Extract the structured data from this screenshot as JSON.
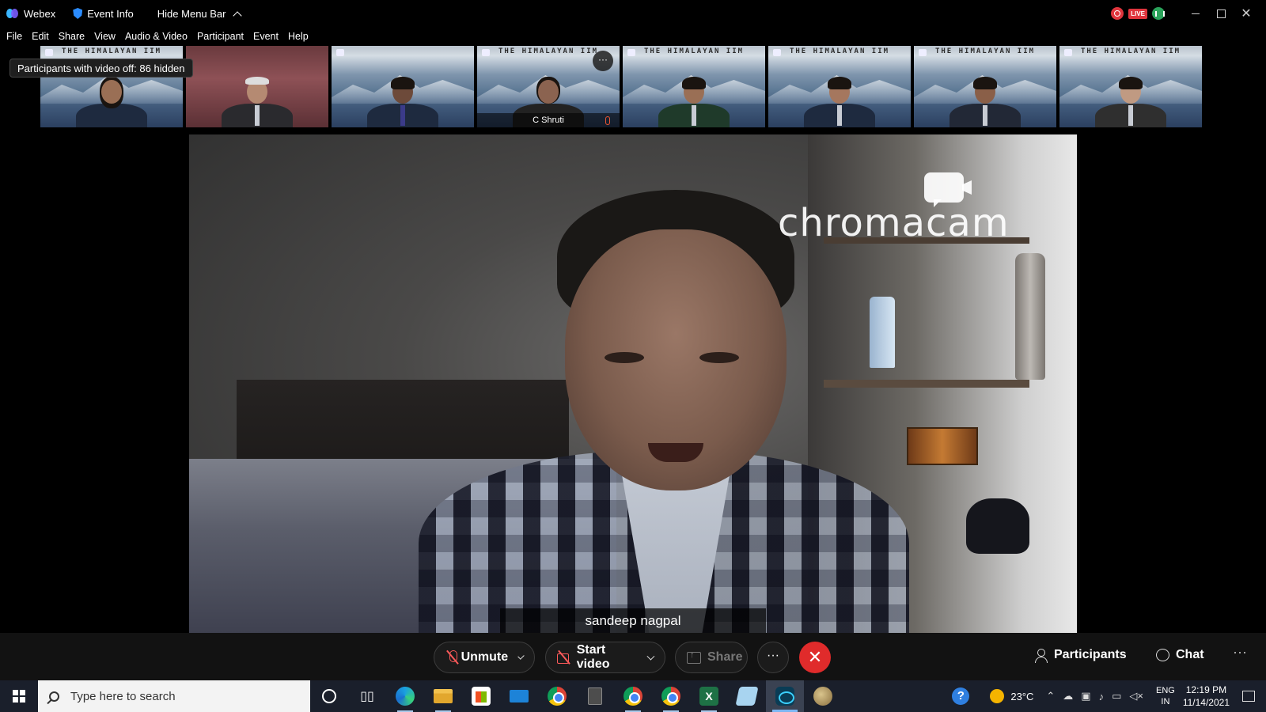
{
  "titlebar": {
    "app_name": "Webex",
    "event_info": "Event Info",
    "hide_menu": "Hide Menu Bar",
    "live_badge": "LIVE"
  },
  "menu": [
    "File",
    "Edit",
    "Share",
    "View",
    "Audio & Video",
    "Participant",
    "Event",
    "Help"
  ],
  "tooltip": "Participants with video off: 86 hidden",
  "thumbnails": {
    "banner": "THE HIMALAYAN IIM",
    "active_name": "C Shruti"
  },
  "main_video": {
    "watermark": "chromacam",
    "speaker_name": "sandeep nagpal"
  },
  "controls": {
    "unmute": "Unmute",
    "start_video": "Start video",
    "share": "Share",
    "more": "···",
    "end": "✕",
    "participants": "Participants",
    "chat": "Chat",
    "side_more": "···"
  },
  "taskbar": {
    "search_placeholder": "Type here to search",
    "excel_letter": "X",
    "help": "?",
    "temperature": "23°C",
    "lang_line1": "ENG",
    "lang_line2": "IN",
    "time": "12:19 PM",
    "date": "11/14/2021"
  },
  "colors": {
    "end_call": "#e02b2b",
    "muted_icon": "#ff5a5a",
    "taskbar": "#1a1f2b"
  }
}
